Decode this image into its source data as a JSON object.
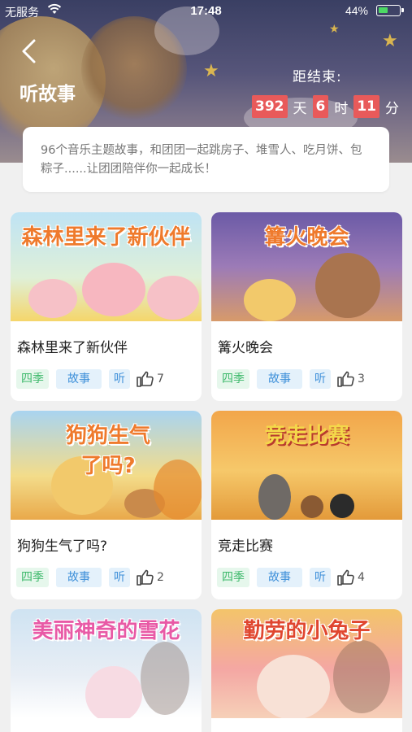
{
  "status_bar": {
    "carrier": "无服务",
    "time": "17:48",
    "battery": "44%"
  },
  "header": {
    "title": "听故事",
    "countdown_label": "距结束:",
    "countdown": [
      {
        "value": "392",
        "unit": "天"
      },
      {
        "value": "6",
        "unit": "时"
      },
      {
        "value": "11",
        "unit": "分"
      }
    ]
  },
  "description": "96个音乐主题故事，和团团一起跳房子、堆雪人、吃月饼、包粽子......让团团陪伴你一起成长！",
  "stories": [
    {
      "thumb_title": "森林里来了新伙伴",
      "name": "森林里来了新伙伴",
      "tags": [
        "四季",
        "故事",
        "听"
      ],
      "likes": "7"
    },
    {
      "thumb_title": "篝火晚会",
      "name": "篝火晚会",
      "tags": [
        "四季",
        "故事",
        "听"
      ],
      "likes": "3"
    },
    {
      "thumb_title": "狗狗生气了吗?",
      "name": "狗狗生气了吗?",
      "tags": [
        "四季",
        "故事",
        "听"
      ],
      "likes": "2"
    },
    {
      "thumb_title": "竞走比赛",
      "name": "竞走比赛",
      "tags": [
        "四季",
        "故事",
        "听"
      ],
      "likes": "4"
    },
    {
      "thumb_title": "美丽神奇的雪花",
      "name": "",
      "tags": [],
      "likes": ""
    },
    {
      "thumb_title": "勤劳的小兔子",
      "name": "",
      "tags": [],
      "likes": ""
    }
  ],
  "colors": {
    "countdown_bg": "#e85a5a",
    "season_tag": "#3cb86a",
    "blue_tag": "#3d8fd9"
  },
  "icons": [
    "wifi-icon",
    "battery-icon",
    "back-chevron-icon",
    "thumbs-up-icon"
  ]
}
